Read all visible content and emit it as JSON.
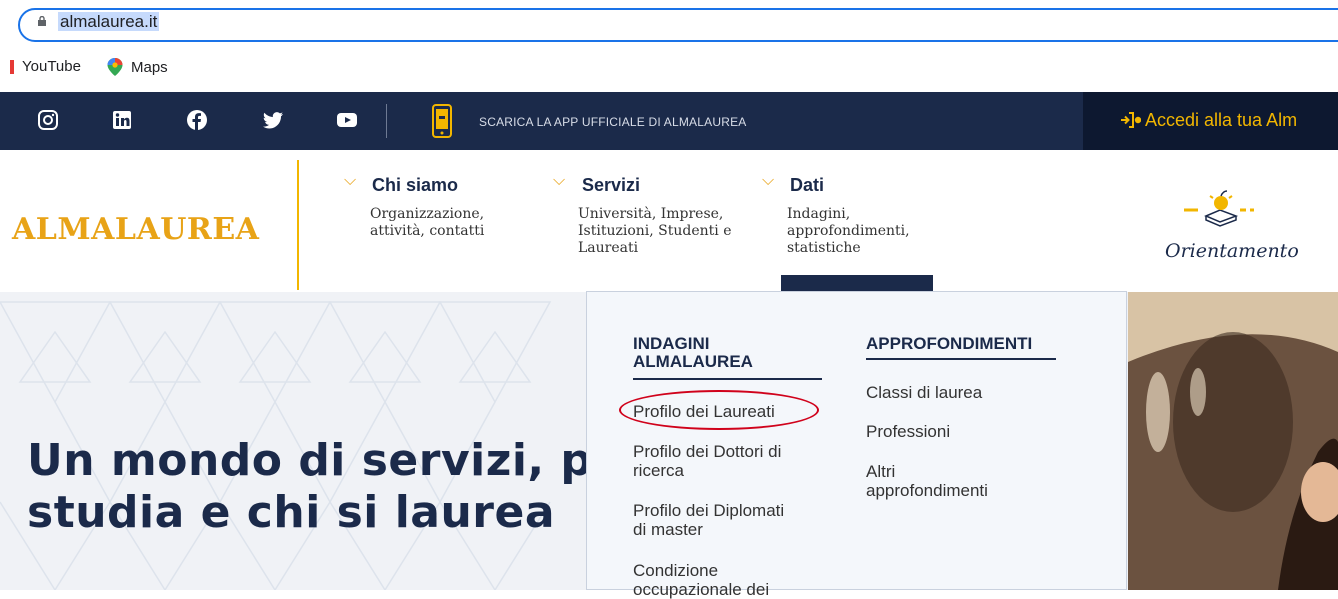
{
  "browser": {
    "url": "almalaurea.it",
    "bookmarks": [
      {
        "label": "YouTube",
        "icon": "youtube-icon"
      },
      {
        "label": "Maps",
        "icon": "maps-pin-icon"
      }
    ]
  },
  "topbar": {
    "social_icons": [
      "instagram-icon",
      "linkedin-icon",
      "facebook-icon",
      "twitter-icon",
      "youtube-icon"
    ],
    "app_text": "SCARICA LA APP UFFICIALE DI ALMALAUREA",
    "login_text": "Accedi alla tua Alm"
  },
  "header": {
    "logo_text": "ALMALAUREA",
    "nav": [
      {
        "label": "Chi siamo",
        "sub": "Organizzazione,\nattività, contatti"
      },
      {
        "label": "Servizi",
        "sub": "Università, Imprese,\nIstituzioni, Studenti e\nLaureati"
      },
      {
        "label": "Dati",
        "sub": "Indagini,\napprofondimenti,\nstatistiche"
      }
    ],
    "orientamento": "Orientamento"
  },
  "hero": {
    "title": "Un mondo di servizi, pe\nstudia e chi si laurea"
  },
  "dropdown": {
    "col1": {
      "title": "INDAGINI\nALMALAUREA",
      "items": [
        "Profilo dei Laureati",
        "Profilo dei Dottori di\nricerca",
        "Profilo dei Diplomati\ndi master",
        "Condizione\noccupazionale dei"
      ]
    },
    "col2": {
      "title": "APPROFONDIMENTI",
      "items": [
        "Classi di laurea",
        "Professioni",
        "Altri\napprofondimenti"
      ]
    }
  },
  "colors": {
    "navy": "#1b2a4a",
    "gold": "#e8a317",
    "highlight_circle": "#d0021b"
  }
}
